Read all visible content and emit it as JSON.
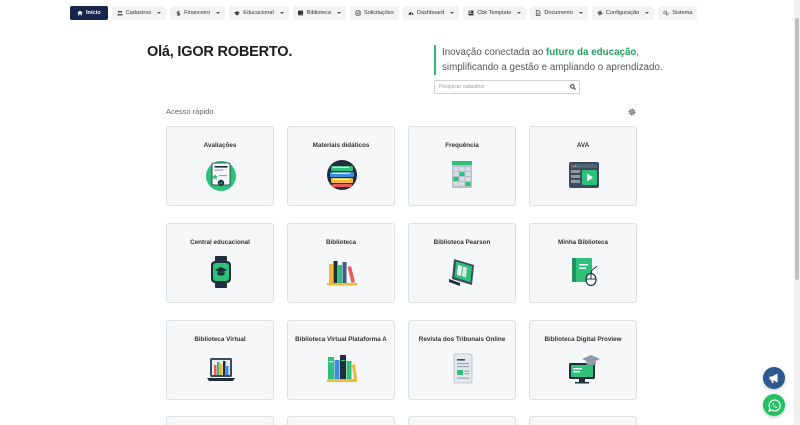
{
  "nav": {
    "items": [
      {
        "label": "Início",
        "icon": "home-icon",
        "caret": false,
        "active": true
      },
      {
        "label": "Cadastros",
        "icon": "users-icon",
        "caret": true
      },
      {
        "label": "Financeiro",
        "icon": "dollar-icon",
        "caret": true
      },
      {
        "label": "Educacional",
        "icon": "graduation-cap-icon",
        "caret": true
      },
      {
        "label": "Biblioteca",
        "icon": "book-icon",
        "caret": true
      },
      {
        "label": "Solicitações",
        "icon": "request-icon",
        "caret": false
      },
      {
        "label": "Dashboard",
        "icon": "dashboard-icon",
        "caret": true
      },
      {
        "label": "Cbk Template",
        "icon": "template-icon",
        "caret": true
      },
      {
        "label": "Documento",
        "icon": "document-icon",
        "caret": true
      },
      {
        "label": "Configuração",
        "icon": "gear-icon",
        "caret": true
      },
      {
        "label": "Sistema",
        "icon": "cogs-icon",
        "caret": false
      }
    ]
  },
  "greeting": "Olá, IGOR ROBERTO.",
  "tagline": {
    "before": "Inovação conectada ao ",
    "highlight": "futuro da educação",
    "after": ", simplificando a gestão e ampliando o aprendizado."
  },
  "search": {
    "placeholder": "Pesquisar cadastros"
  },
  "quick_access": {
    "title": "Acesso rápido",
    "cards": [
      {
        "label": "Avaliações",
        "icon": "evaluation-icon"
      },
      {
        "label": "Materiais didáticos",
        "icon": "books-stack-icon"
      },
      {
        "label": "Frequência",
        "icon": "attendance-table-icon"
      },
      {
        "label": "AVA",
        "icon": "video-player-icon"
      },
      {
        "label": "Central educacional",
        "icon": "smartwatch-graduation-icon"
      },
      {
        "label": "Biblioteca",
        "icon": "bookshelf-icon"
      },
      {
        "label": "Biblioteca Pearson",
        "icon": "tablet-book-icon"
      },
      {
        "label": "Minha Biblioteca",
        "icon": "book-mouse-icon"
      },
      {
        "label": "Biblioteca Virtual",
        "icon": "laptop-books-icon"
      },
      {
        "label": "Biblioteca Virtual Plataforma A",
        "icon": "books-row-icon"
      },
      {
        "label": "Revista dos Tribunais Online",
        "icon": "document-list-icon"
      },
      {
        "label": "Biblioteca Digital Proview",
        "icon": "monitor-graduation-icon"
      }
    ]
  },
  "colors": {
    "nav_active": "#14264a",
    "accent_green": "#23a25e",
    "fab_blue": "#2d5a8e",
    "fab_green": "#25c063"
  }
}
